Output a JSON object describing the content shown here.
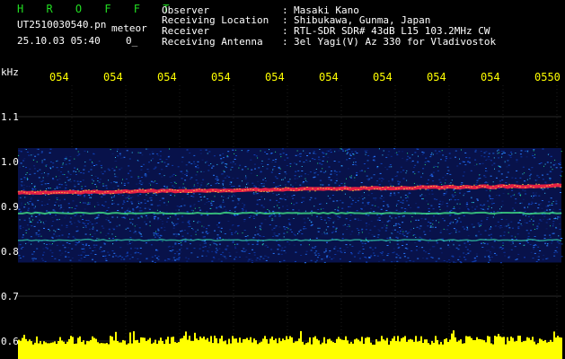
{
  "header": {
    "brand": "H R O F F T",
    "filename": "UT2510030540.pn",
    "mode": "meteor",
    "datetime": "25.10.03 05:40",
    "counter": "0_",
    "fields": [
      {
        "label": "Observer",
        "value": "Masaki Kano"
      },
      {
        "label": "Receiving Location",
        "value": "Shibukawa, Gunma, Japan"
      },
      {
        "label": "Receiver",
        "value": "RTL-SDR SDR# 43dB L15 103.2MHz CW"
      },
      {
        "label": "Receiving Antenna",
        "value": "3el Yagi(V) Az 330 for Vladivostok"
      }
    ]
  },
  "axis": {
    "unit": "kHz",
    "y_ticks": [
      "1.1",
      "1.0",
      "0.9",
      "0.8",
      "0.7",
      "0.6"
    ],
    "time_ticks": [
      "054",
      "054",
      "054",
      "054",
      "054",
      "054",
      "054",
      "054",
      "054",
      "0550"
    ]
  },
  "colors": {
    "background": "#000000",
    "header_text": "#ffffff",
    "brand": "#22dd22",
    "time_labels": "#ffff00",
    "noise_bar": "#ffff00",
    "echo_line": "#ff2244"
  },
  "chart_data": {
    "type": "heatmap",
    "x_ticks": [
      "054",
      "054",
      "054",
      "054",
      "054",
      "054",
      "054",
      "054",
      "054",
      "0550"
    ],
    "y_ticks": [
      "1.1",
      "1.0",
      "0.9",
      "0.8",
      "0.7",
      "0.6"
    ],
    "ylabel": "kHz",
    "ylim": [
      0.6,
      1.15
    ],
    "noise_band_khz": [
      0.775,
      1.03
    ],
    "carrier_lines_khz": [
      0.93,
      0.885,
      0.825
    ],
    "grid": true
  }
}
